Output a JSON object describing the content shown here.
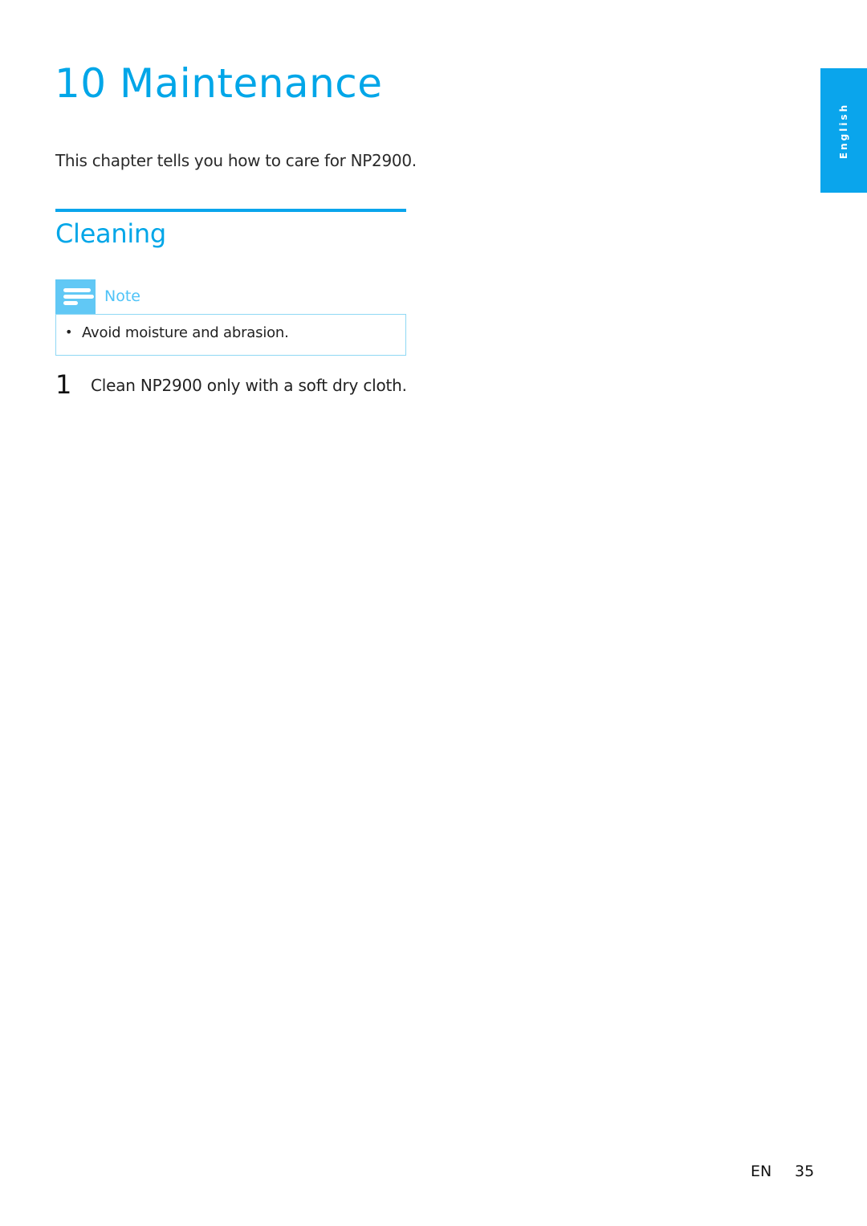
{
  "chapter": {
    "title": "10 Maintenance",
    "intro": "This chapter tells you how to care for NP2900."
  },
  "section": {
    "title": "Cleaning"
  },
  "note": {
    "icon": "note-lines-icon",
    "label": "Note",
    "bullet": "•",
    "items": [
      "Avoid moisture and abrasion."
    ]
  },
  "steps": [
    {
      "number": "1",
      "text": "Clean NP2900 only with a soft dry cloth."
    }
  ],
  "side_tab": {
    "label": "English"
  },
  "footer": {
    "lang": "EN",
    "page": "35"
  },
  "colors": {
    "accent": "#0aa5ec",
    "note_icon": "#61c8f5",
    "note_border": "#8fd8f4"
  }
}
